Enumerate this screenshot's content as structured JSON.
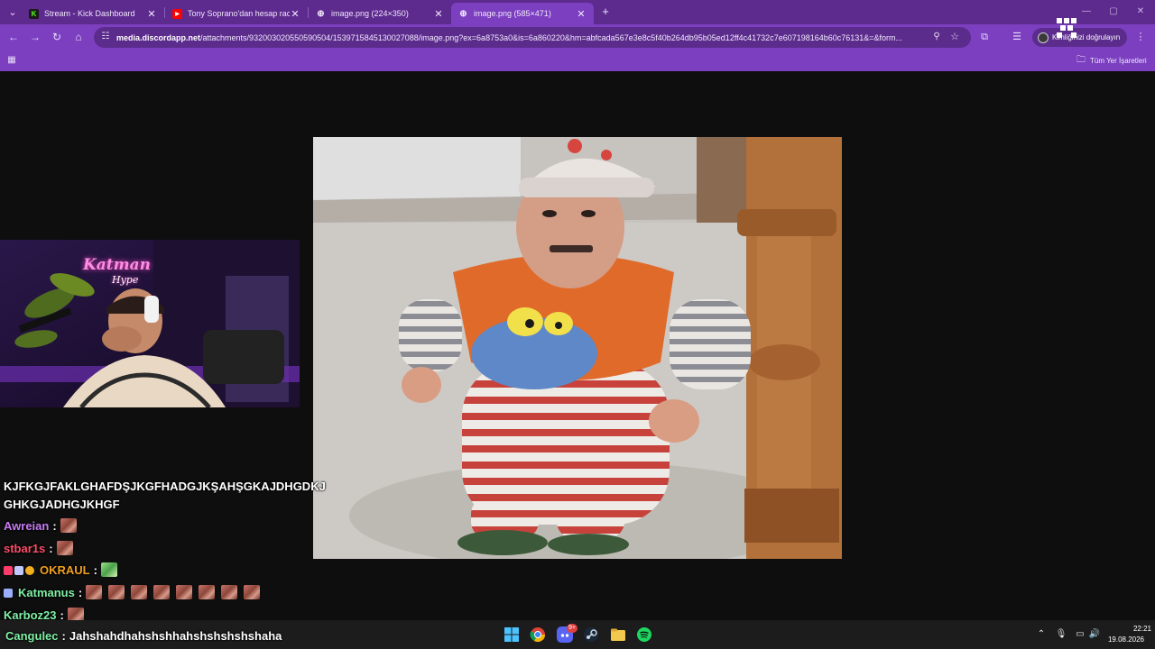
{
  "browser": {
    "tabs": [
      {
        "title": "Stream - Kick Dashboard",
        "favicon": "kick-icon",
        "active": false
      },
      {
        "title": "Tony Soprano'dan hesap racon",
        "favicon": "youtube-icon",
        "active": false
      },
      {
        "title": "image.png (224×350)",
        "favicon": "globe-icon",
        "active": false
      },
      {
        "title": "image.png (585×471)",
        "favicon": "globe-icon",
        "active": true
      }
    ],
    "close_glyph": "✕",
    "new_tab_glyph": "+",
    "url_host": "media.discordapp.net",
    "url_path": "/attachments/932003020550590504/1539715845130027088/image.png?ex=6a8753a0&is=6a860220&hm=abfcada567e3e8c5f40b264db95b05ed12ff4c41732c7e607198164b60c76131&=&form...",
    "verify_label": "Kimliğinizi doğrulayın",
    "bookmarks_all_label": "Tüm Yer İşaretleri",
    "accent": "#7b3fc0",
    "tabstrip_color": "#5d2a8e"
  },
  "stream": {
    "webcam_logo_line1": "Katman",
    "webcam_logo_line2": "Hype"
  },
  "chat": [
    {
      "user": "",
      "message": "KJFKGJFAKLGHAFDŞJKGFHADGJKŞAHŞGKAJDHGDKJ",
      "color": "#ffffff"
    },
    {
      "user": "",
      "message": "GHKGJADHGJKHGF",
      "color": "#ffffff"
    },
    {
      "user": "Awreian",
      "emotes": 1,
      "color": "#c57cf2"
    },
    {
      "user": "stbar1s",
      "emotes": 1,
      "color": "#ff4d6a"
    },
    {
      "user": "OKRAUL",
      "emotes": 1,
      "emote_style": "green",
      "color": "#f0a020",
      "badges": 3
    },
    {
      "user": "Katmanus",
      "emotes": 8,
      "color": "#7ff0a6",
      "badges": 1
    },
    {
      "user": "Karboz23",
      "emotes": 1,
      "color": "#7ff0a6"
    },
    {
      "user": "Cangulec",
      "message": "Jahshahdhahshshhahshshshshshaha",
      "color": "#7ff0a6"
    }
  ],
  "taskbar": {
    "time": "22:21",
    "date": "19.08.2026",
    "discord_badge": "9+"
  }
}
